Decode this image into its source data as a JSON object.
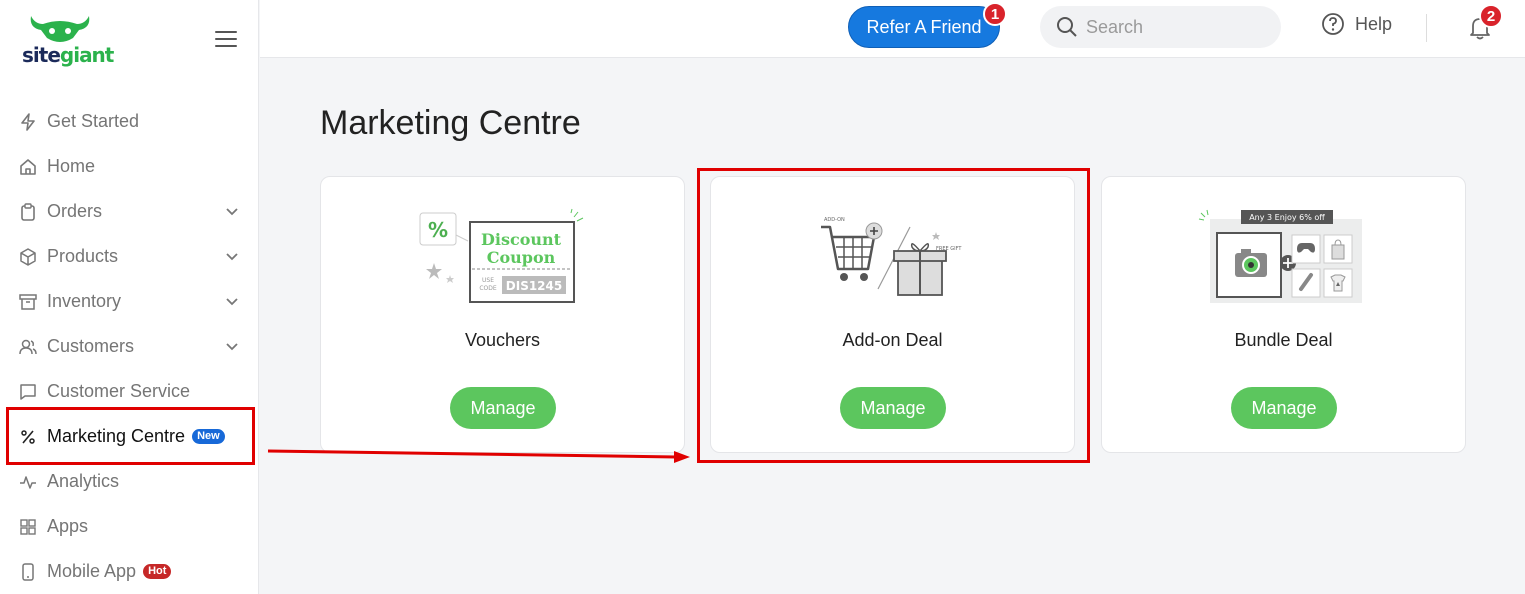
{
  "brand": {
    "logo_part1": "site",
    "logo_part2": "giant",
    "accent": "#5cc65e",
    "primary": "#1679df"
  },
  "sidebar": {
    "items": [
      {
        "label": "Get Started",
        "icon": "lightning-icon",
        "chevron": false
      },
      {
        "label": "Home",
        "icon": "home-icon",
        "chevron": false
      },
      {
        "label": "Orders",
        "icon": "clipboard-icon",
        "chevron": true
      },
      {
        "label": "Products",
        "icon": "box-icon",
        "chevron": true
      },
      {
        "label": "Inventory",
        "icon": "archive-icon",
        "chevron": true
      },
      {
        "label": "Customers",
        "icon": "users-icon",
        "chevron": true
      },
      {
        "label": "Customer Service",
        "icon": "chat-icon",
        "chevron": false
      },
      {
        "label": "Marketing Centre",
        "icon": "percent-icon",
        "chevron": false,
        "badge": "New",
        "active": true
      },
      {
        "label": "Analytics",
        "icon": "pulse-icon",
        "chevron": false
      },
      {
        "label": "Apps",
        "icon": "grid-icon",
        "chevron": false
      },
      {
        "label": "Mobile App",
        "icon": "phone-icon",
        "chevron": false,
        "badge": "Hot"
      }
    ]
  },
  "topbar": {
    "refer_label": "Refer A Friend",
    "refer_count": "1",
    "search_placeholder": "Search",
    "help_label": "Help",
    "notification_count": "2"
  },
  "main": {
    "title": "Marketing Centre",
    "cards": [
      {
        "name": "Vouchers",
        "button": "Manage",
        "illus": {
          "line1": "Discount",
          "line2": "Coupon",
          "use": "USE",
          "code": "CODE",
          "code_value": "DIS1245",
          "percent": "%"
        }
      },
      {
        "name": "Add-on Deal",
        "button": "Manage",
        "illus": {
          "addon": "ADD-ON",
          "free_gift": "FREE GIFT"
        }
      },
      {
        "name": "Bundle Deal",
        "button": "Manage",
        "illus": {
          "banner": "Any 3 Enjoy 6% off"
        }
      }
    ]
  }
}
